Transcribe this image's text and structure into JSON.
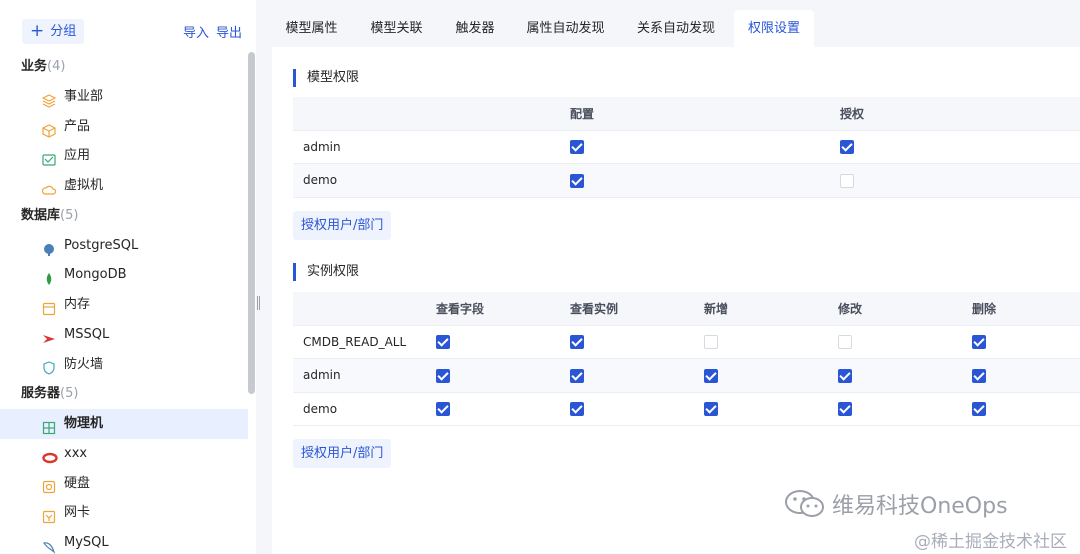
{
  "sidebar": {
    "add_group_label": "分组",
    "import_label": "导入",
    "export_label": "导出",
    "groups": [
      {
        "title": "业务",
        "count": "(4)",
        "items": [
          {
            "label": "事业部",
            "icon": "layers-icon",
            "color": "#f0a23a"
          },
          {
            "label": "产品",
            "icon": "cube-icon",
            "color": "#f0a23a"
          },
          {
            "label": "应用",
            "icon": "app-window-icon",
            "color": "#3aa776"
          },
          {
            "label": "虚拟机",
            "icon": "cloud-server-icon",
            "color": "#f0a23a"
          }
        ]
      },
      {
        "title": "数据库",
        "count": "(5)",
        "items": [
          {
            "label": "PostgreSQL",
            "icon": "postgresql-icon",
            "color": "#4b7fb8"
          },
          {
            "label": "MongoDB",
            "icon": "mongodb-leaf-icon",
            "color": "#2f9c45"
          },
          {
            "label": "内存",
            "icon": "memory-icon",
            "color": "#f0a23a"
          },
          {
            "label": "MSSQL",
            "icon": "mssql-icon",
            "color": "#d8382e"
          },
          {
            "label": "防火墙",
            "icon": "firewall-shield-icon",
            "color": "#3aa7c9"
          }
        ]
      },
      {
        "title": "服务器",
        "count": "(5)",
        "items": [
          {
            "label": "物理机",
            "icon": "physical-server-icon",
            "color": "#3aa776",
            "selected": true
          },
          {
            "label": "xxx",
            "icon": "oracle-ring-icon",
            "color": "#d8382e"
          },
          {
            "label": "硬盘",
            "icon": "disk-icon",
            "color": "#f0a23a"
          },
          {
            "label": "网卡",
            "icon": "network-card-icon",
            "color": "#f0a23a"
          },
          {
            "label": "MySQL",
            "icon": "mysql-dolphin-icon",
            "color": "#4b7fb8"
          }
        ]
      }
    ]
  },
  "tabs": [
    {
      "label": "模型属性"
    },
    {
      "label": "模型关联"
    },
    {
      "label": "触发器"
    },
    {
      "label": "属性自动发现"
    },
    {
      "label": "关系自动发现"
    },
    {
      "label": "权限设置",
      "active": true
    }
  ],
  "model_perm": {
    "title": "模型权限",
    "columns": [
      "",
      "配置",
      "授权"
    ],
    "rows": [
      {
        "name": "admin",
        "values": [
          true,
          true
        ]
      },
      {
        "name": "demo",
        "values": [
          true,
          false
        ]
      }
    ],
    "grant_label": "授权用户/部门"
  },
  "instance_perm": {
    "title": "实例权限",
    "columns": [
      "",
      "查看字段",
      "查看实例",
      "新增",
      "修改",
      "删除"
    ],
    "rows": [
      {
        "name": "CMDB_READ_ALL",
        "values": [
          true,
          true,
          false,
          false,
          true
        ]
      },
      {
        "name": "admin",
        "values": [
          true,
          true,
          true,
          true,
          true
        ]
      },
      {
        "name": "demo",
        "values": [
          true,
          true,
          true,
          true,
          true
        ]
      }
    ],
    "grant_label": "授权用户/部门"
  },
  "watermark": {
    "main": "维易科技OneOps",
    "sub": "@稀土掘金技术社区"
  },
  "colors": {
    "accent": "#2a56d6",
    "selected_bg": "#e8efff",
    "button_bg": "#eef3fd"
  }
}
